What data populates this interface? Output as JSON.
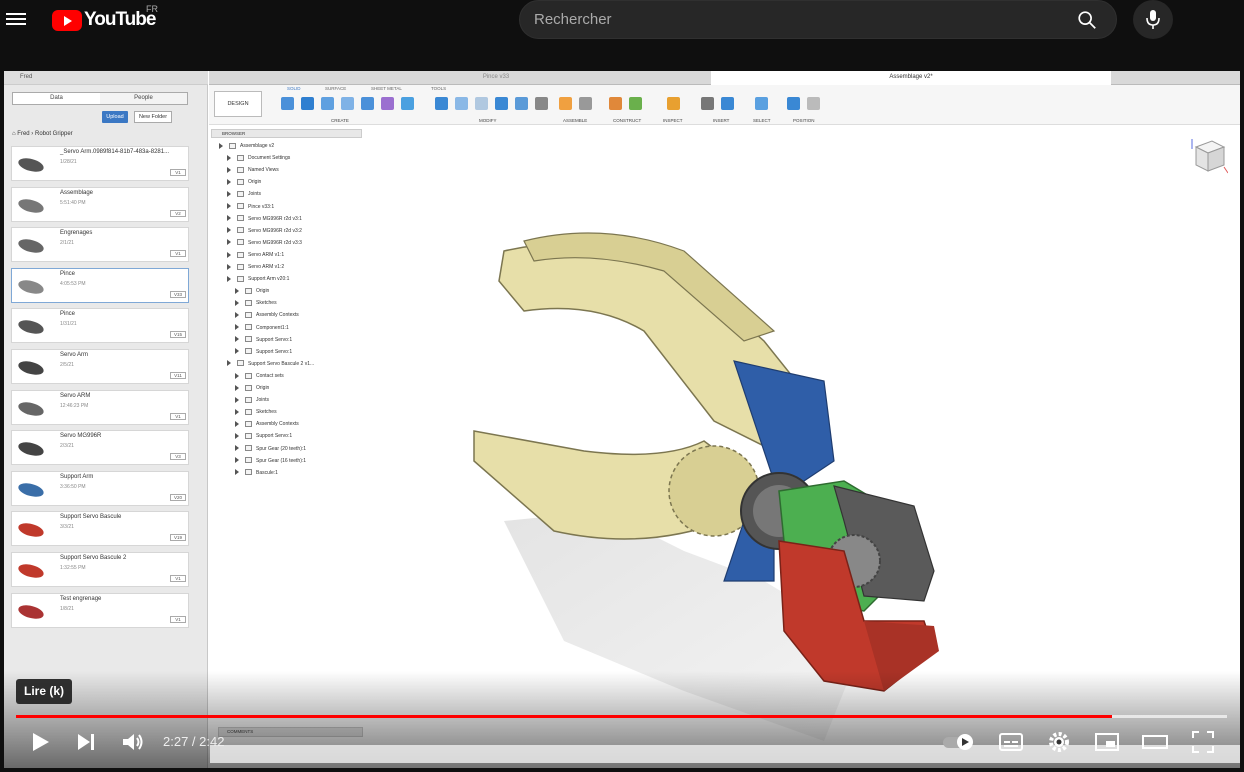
{
  "youtube": {
    "logo_text": "YouTube",
    "region": "FR",
    "search_placeholder": "Rechercher"
  },
  "fusion": {
    "user": "Fred",
    "tabs": {
      "data": "Data",
      "people": "People"
    },
    "upload": "Upload",
    "new_folder": "New Folder",
    "breadcrumb": [
      "Fred",
      "Robot Gripper"
    ],
    "files": [
      {
        "name": "_Servo Arm.0989f814-81b7-483a-8281...",
        "date": "1/28/21",
        "version": "V1"
      },
      {
        "name": "Assemblage",
        "date": "5:51:40 PM",
        "version": "V2"
      },
      {
        "name": "Engrenages",
        "date": "2/1/21",
        "version": "V1"
      },
      {
        "name": "Pince",
        "date": "4:05:53 PM",
        "version": "V33"
      },
      {
        "name": "Pince",
        "date": "1/31/21",
        "version": "V15"
      },
      {
        "name": "Servo Arm",
        "date": "2/5/21",
        "version": "V11"
      },
      {
        "name": "Servo ARM",
        "date": "12:46:23 PM",
        "version": "V1"
      },
      {
        "name": "Servo MG996R",
        "date": "2/3/21",
        "version": "V3"
      },
      {
        "name": "Support Arm",
        "date": "3:36:50 PM",
        "version": "V20"
      },
      {
        "name": "Support Servo Bascule",
        "date": "3/3/21",
        "version": "V19"
      },
      {
        "name": "Support Servo Bascule 2",
        "date": "1:32:55 PM",
        "version": "V1"
      },
      {
        "name": "Test engrenage",
        "date": "1/8/21",
        "version": "V1"
      }
    ],
    "doc_tabs": [
      "Pince v33",
      "Assemblage v2*"
    ],
    "workspace": "DESIGN",
    "toolbar_tabs": [
      "SOLID",
      "SURFACE",
      "SHEET METAL",
      "TOOLS"
    ],
    "toolbar_groups": [
      "CREATE",
      "MODIFY",
      "ASSEMBLE",
      "CONSTRUCT",
      "INSPECT",
      "INSERT",
      "SELECT",
      "POSITION"
    ],
    "browser_title": "BROWSER",
    "browser_nodes": [
      "Assemblage v2",
      "Document Settings",
      "Named Views",
      "Origin",
      "Joints",
      "Pince v33:1",
      "Servo MG996R r2d v3:1",
      "Servo MG996R r2d v3:2",
      "Servo MG996R r2d v3:3",
      "Servo ARM v1:1",
      "Servo ARM v1:2",
      "Support Arm v20:1",
      "Origin",
      "Sketches",
      "Assembly Contexts",
      "Component1:1",
      "Support Servo:1",
      "Support Servo:1",
      "Support Servo Bascule 2 v1...",
      "Contact sets",
      "Origin",
      "Joints",
      "Sketches",
      "Assembly Contexts",
      "Support Servo:1",
      "Spur Gear (20 teeth):1",
      "Spur Gear (16 teeth):1",
      "Bascule:1"
    ],
    "comments": "COMMENTS"
  },
  "player": {
    "tooltip": "Lire (k)",
    "current_time": "2:27",
    "duration": "2:42",
    "progress": 0.905,
    "buffered": 1.0,
    "accent": "#ff0000"
  }
}
